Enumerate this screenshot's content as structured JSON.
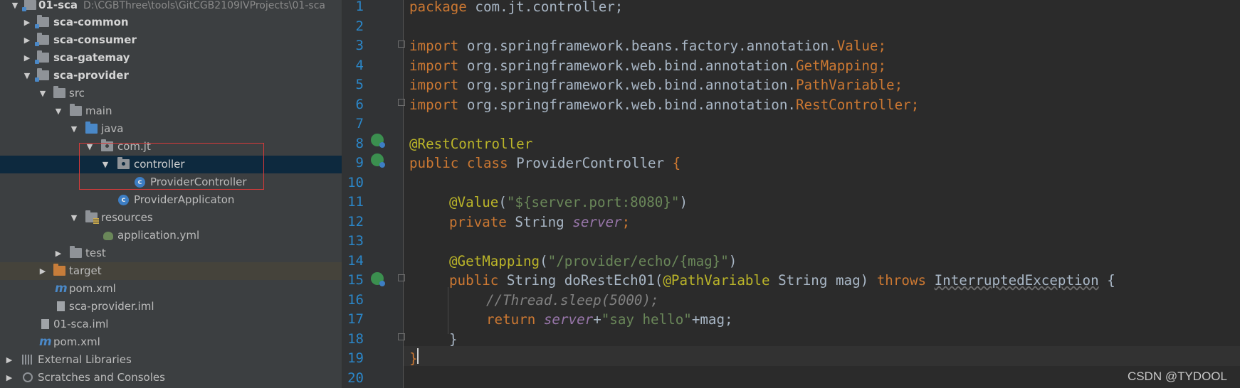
{
  "project_tree": {
    "root": {
      "name": "01-sca",
      "path": "D:\\CGBThree\\tools\\GitCGB2109IVProjects\\01-sca"
    },
    "items": [
      {
        "label": "sca-common"
      },
      {
        "label": "sca-consumer"
      },
      {
        "label": "sca-gatemay"
      },
      {
        "label": "sca-provider"
      },
      {
        "label": "src"
      },
      {
        "label": "main"
      },
      {
        "label": "java"
      },
      {
        "label": "com.jt"
      },
      {
        "label": "controller"
      },
      {
        "label": "ProviderController"
      },
      {
        "label": "ProviderApplicaton"
      },
      {
        "label": "resources"
      },
      {
        "label": "application.yml"
      },
      {
        "label": "test"
      },
      {
        "label": "target"
      },
      {
        "label": "pom.xml"
      },
      {
        "label": "sca-provider.iml"
      },
      {
        "label": "01-sca.iml"
      },
      {
        "label": "pom.xml"
      },
      {
        "label": "External Libraries"
      },
      {
        "label": "Scratches and Consoles"
      }
    ]
  },
  "editor": {
    "line_numbers": [
      "1",
      "2",
      "3",
      "4",
      "5",
      "6",
      "7",
      "8",
      "9",
      "10",
      "11",
      "12",
      "13",
      "14",
      "15",
      "16",
      "17",
      "18",
      "19",
      "20"
    ],
    "lines": [
      {
        "kw": "package",
        "rest": " com.jt.controller;"
      },
      {
        "kw": "import",
        "pkg": " org.springframework.beans.factory.annotation.",
        "cls": "Value",
        "end": ";"
      },
      {
        "kw": "import",
        "pkg": " org.springframework.web.bind.annotation.",
        "cls": "GetMapping",
        "end": ";"
      },
      {
        "kw": "import",
        "pkg": " org.springframework.web.bind.annotation.",
        "cls": "PathVariable",
        "end": ";"
      },
      {
        "kw": "import",
        "pkg": " org.springframework.web.bind.annotation.",
        "cls": "RestController",
        "end": ";"
      },
      {
        "ann": "@RestController"
      },
      {
        "kw": "public class",
        "name": " ProviderController ",
        "brace": "{"
      },
      {
        "ann": "@Value",
        "open": "(",
        "str": "\"${server.port:8080}\"",
        "close": ")"
      },
      {
        "kw": "private",
        "type": " String ",
        "field": "server",
        "end": ";"
      },
      {
        "ann": "@GetMapping",
        "open": "(",
        "str": "\"/provider/echo/{mag}\"",
        "close": ")"
      },
      {
        "kw": "public",
        "sig1": " String doRestEch01(",
        "ann2": "@PathVariable",
        "sig2": " String mag) ",
        "kw2": "throws",
        "exc": "InterruptedException",
        "brace": " {"
      },
      {
        "comment": "//Thread.sleep(5000);"
      },
      {
        "kw": "return",
        "field": " server",
        "plus1": "+",
        "str": "\"say hello\"",
        "plus2": "+mag;"
      },
      {
        "brace": "}"
      },
      {
        "brace": "}"
      }
    ]
  },
  "watermark": "CSDN @TYDOOL"
}
